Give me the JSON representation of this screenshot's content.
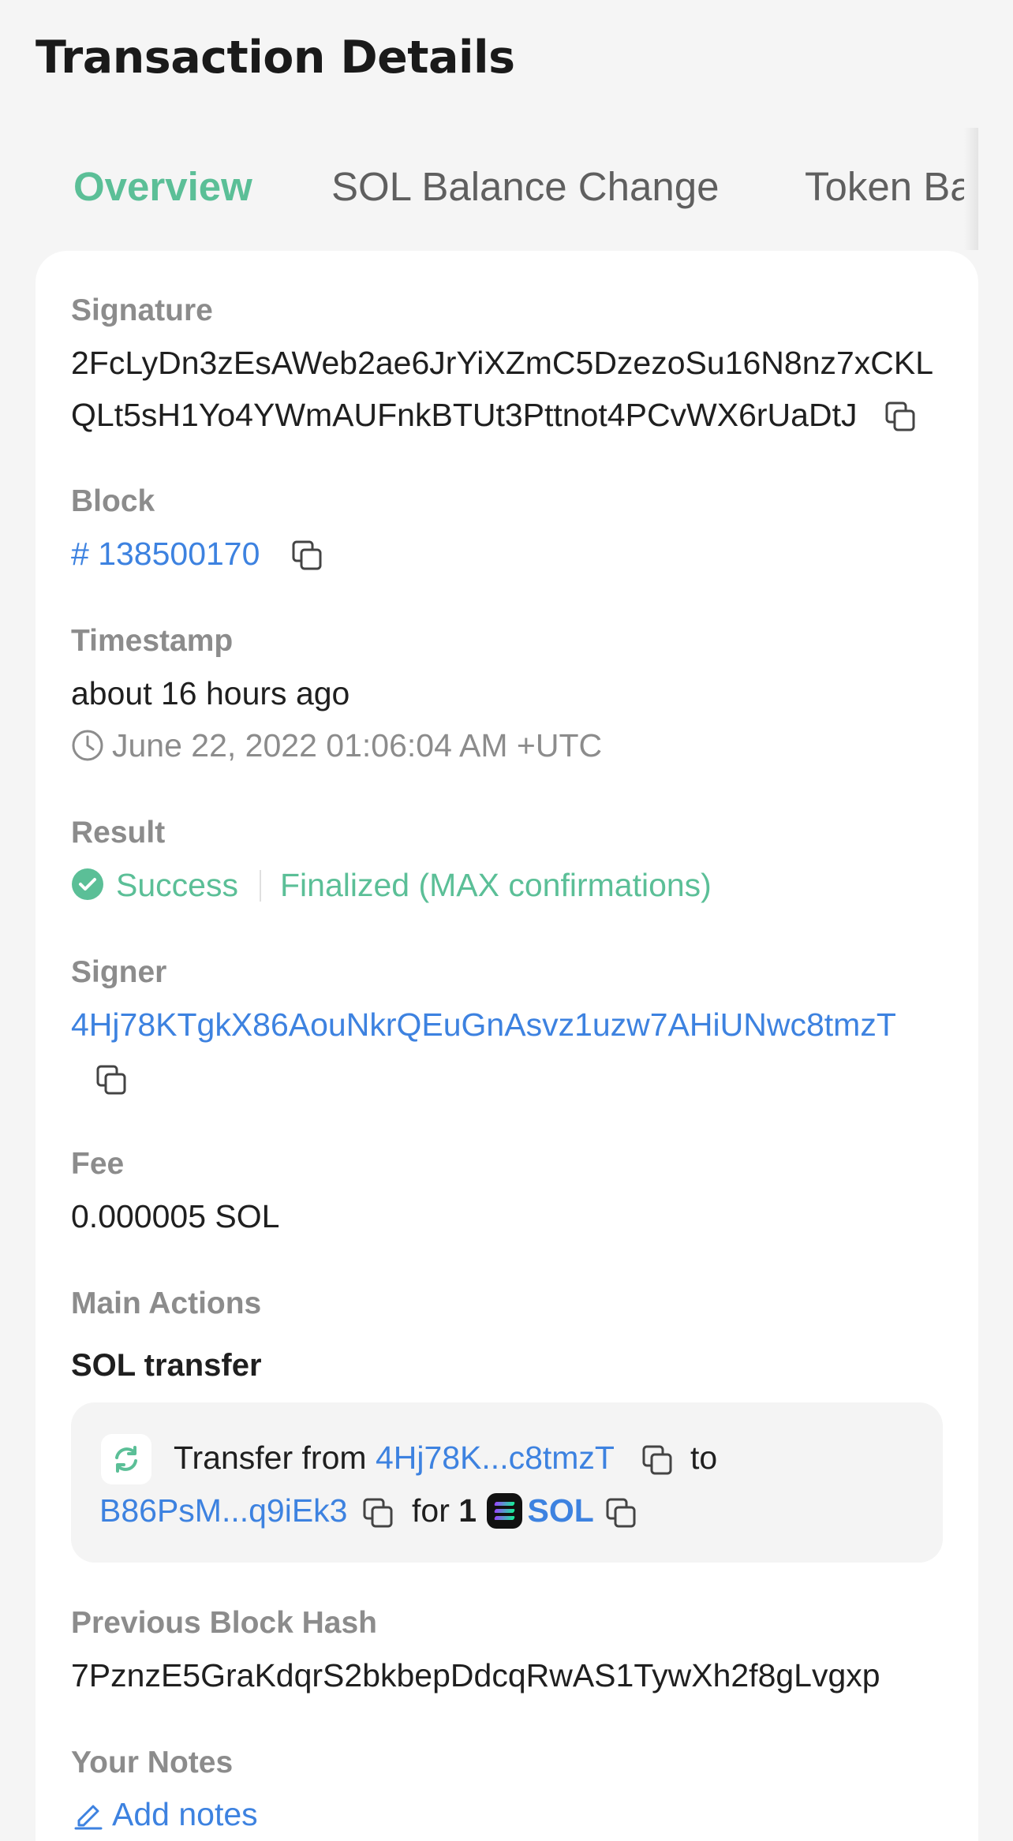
{
  "page_title": "Transaction Details",
  "tabs": [
    {
      "label": "Overview",
      "active": true
    },
    {
      "label": "SOL Balance Change",
      "active": false
    },
    {
      "label": "Token Ba",
      "active": false
    }
  ],
  "signature": {
    "label": "Signature",
    "line1": "2FcLyDn3zEsAWeb2ae6JrYiXZmC5DzezoSu16N8nz7xCKL",
    "line2": "QLt5sH1Yo4YWmAUFnkBTUt3Pttnot4PCvWX6rUaDtJ"
  },
  "block": {
    "label": "Block",
    "value": "# 138500170"
  },
  "timestamp": {
    "label": "Timestamp",
    "relative": "about 16 hours ago",
    "absolute": "June 22, 2022 01:06:04 AM +UTC"
  },
  "result": {
    "label": "Result",
    "status": "Success",
    "confirmation": "Finalized (MAX confirmations)"
  },
  "signer": {
    "label": "Signer",
    "address": "4Hj78KTgkX86AouNkrQEuGnAsvz1uzw7AHiUNwc8tmzT"
  },
  "fee": {
    "label": "Fee",
    "value": "0.000005 SOL"
  },
  "main_actions": {
    "label": "Main Actions",
    "action_title": "SOL transfer",
    "transfer": {
      "prefix": "Transfer from",
      "from": "4Hj78K...c8tmzT",
      "to_word": "to",
      "to": "B86PsM...q9iEk3",
      "for_word": "for",
      "amount": "1",
      "token": "SOL"
    }
  },
  "previous_block_hash": {
    "label": "Previous Block Hash",
    "value": "7PznzE5GraKdqrS2bkbepDdcqRwAS1TywXh2f8gLvgxp"
  },
  "notes": {
    "label": "Your Notes",
    "add_label": "Add notes"
  },
  "colors": {
    "accent_green": "#5bbf97",
    "link_blue": "#3d82e0",
    "label_grey": "#8c8c8c"
  }
}
